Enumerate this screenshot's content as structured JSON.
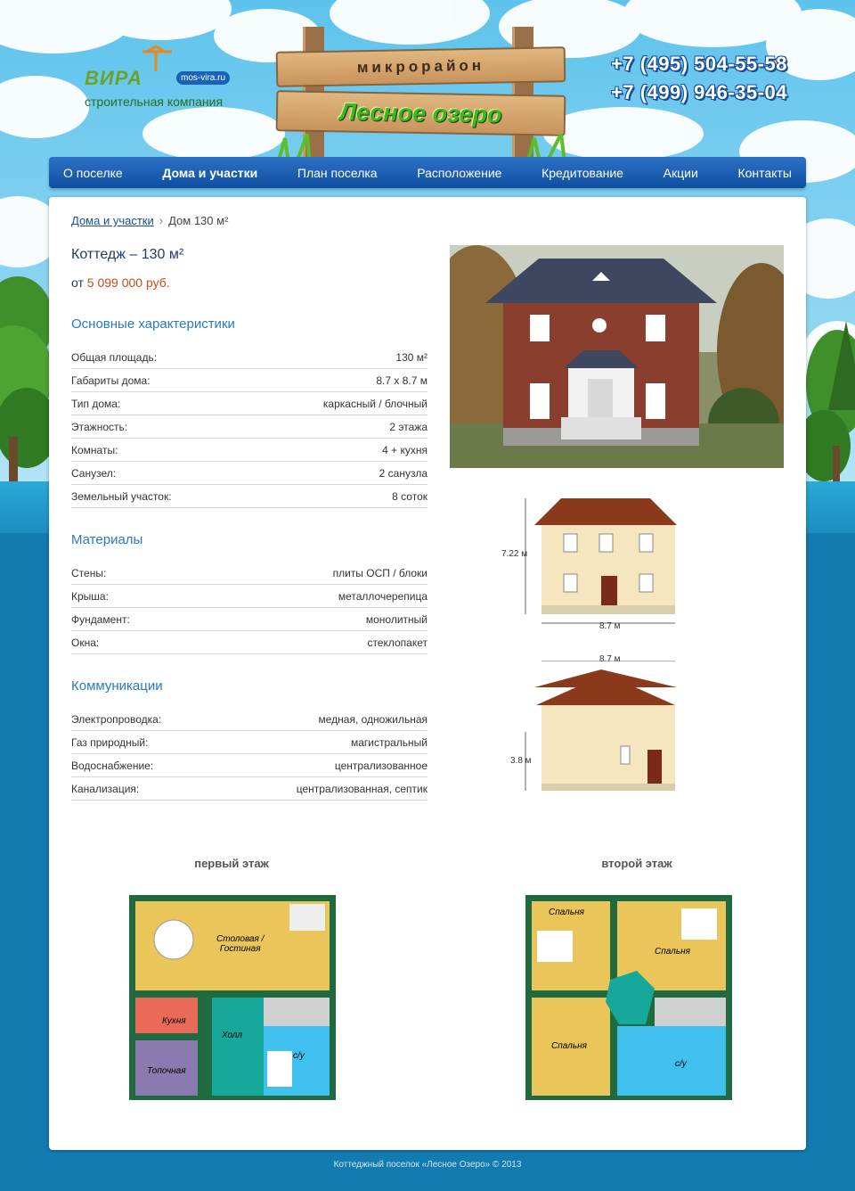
{
  "logo": {
    "word": "ВИРА",
    "site": "mos-vira.ru",
    "subtitle": "строительная компания"
  },
  "sign": {
    "top": "микрорайон",
    "main": "Лесное озеро"
  },
  "phones": [
    "+7 (495) 504-55-58",
    "+7 (499) 946-35-04"
  ],
  "nav": {
    "items": [
      "О поселке",
      "Дома и участки",
      "План поселка",
      "Расположение",
      "Кредитование",
      "Акции",
      "Контакты"
    ],
    "active": 1
  },
  "breadcrumb": {
    "link": "Дома и участки",
    "sep": "›",
    "current": "Дом 130 м²"
  },
  "house": {
    "title": "Коттедж – 130 м²",
    "price_prefix": "от",
    "price": "5 099 000 руб."
  },
  "specs": {
    "heading": "Основные характеристики",
    "rows": [
      {
        "k": "Общая площадь:",
        "v": "130 м²"
      },
      {
        "k": "Габариты дома:",
        "v": "8.7 x 8.7 м"
      },
      {
        "k": "Тип дома:",
        "v": "каркасный / блочный"
      },
      {
        "k": "Этажность:",
        "v": "2 этажа"
      },
      {
        "k": "Комнаты:",
        "v": "4 + кухня"
      },
      {
        "k": "Санузел:",
        "v": "2 санузла"
      },
      {
        "k": "Земельный участок:",
        "v": "8 соток"
      }
    ]
  },
  "materials": {
    "heading": "Материалы",
    "rows": [
      {
        "k": "Стены:",
        "v": "плиты ОСП / блоки"
      },
      {
        "k": "Крыша:",
        "v": "металлочерепица"
      },
      {
        "k": "Фундамент:",
        "v": "монолитный"
      },
      {
        "k": "Окна:",
        "v": "стеклопакет"
      }
    ]
  },
  "utilities": {
    "heading": "Коммуникации",
    "rows": [
      {
        "k": "Электропроводка:",
        "v": "медная, одножильная"
      },
      {
        "k": "Газ природный:",
        "v": "магистральный"
      },
      {
        "k": "Водоснабжение:",
        "v": "централизованное"
      },
      {
        "k": "Канализация:",
        "v": "централизованная, септик"
      }
    ]
  },
  "facade_front": {
    "height": "7.22 м",
    "width": "8.7 м"
  },
  "facade_side": {
    "height": "3.8 м",
    "width": "8.7 м"
  },
  "plan1": {
    "title": "первый этаж",
    "rooms": {
      "living": "Столовая /\nГостиная",
      "kitchen": "Кухня",
      "hall": "Холл",
      "boiler": "Топочная",
      "bath": "с/у"
    }
  },
  "plan2": {
    "title": "второй этаж",
    "rooms": {
      "bed1": "Спальня",
      "bed2": "Спальня",
      "bed3": "Спальня",
      "bath": "с/у"
    }
  },
  "footer": "Коттеджный поселок «Лесное Озеро» © 2013",
  "colors": {
    "nav": "#1a5fb4",
    "accent": "#2a79c5",
    "price": "#c84b1a",
    "wall": "#f5e6bf",
    "roof": "#8a3a1a",
    "plan_wall": "#1f6a3e"
  }
}
